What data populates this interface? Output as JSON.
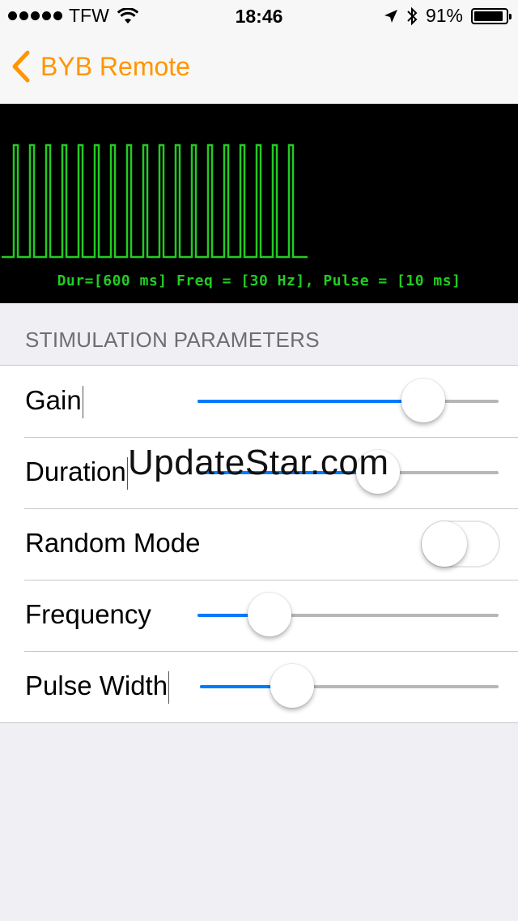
{
  "status_bar": {
    "carrier": "TFW",
    "time": "18:46",
    "battery_percent": "91%",
    "battery_level": 0.91,
    "icons": [
      "signal-dots-icon",
      "wifi-icon",
      "location-arrow-icon",
      "bluetooth-icon",
      "battery-icon"
    ]
  },
  "nav": {
    "back_label": "BYB Remote",
    "tint_color": "#ff9500"
  },
  "scope": {
    "caption": "Dur=[600 ms] Freq = [30 Hz], Pulse = [10 ms]",
    "trace_color": "#22cc22",
    "pulse_count": 18
  },
  "section": {
    "title": "STIMULATION PARAMETERS"
  },
  "rows": {
    "gain": {
      "label": "Gain",
      "value": 0.75
    },
    "duration": {
      "label": "Duration",
      "value": 0.6
    },
    "random_mode": {
      "label": "Random Mode",
      "on": false
    },
    "frequency": {
      "label": "Frequency",
      "value": 0.24
    },
    "pulse_width": {
      "label": "Pulse Width",
      "value": 0.31
    }
  },
  "watermark": "UpdateStar.com",
  "colors": {
    "slider_fill": "#007aff",
    "slider_track": "#b7b7b7"
  }
}
